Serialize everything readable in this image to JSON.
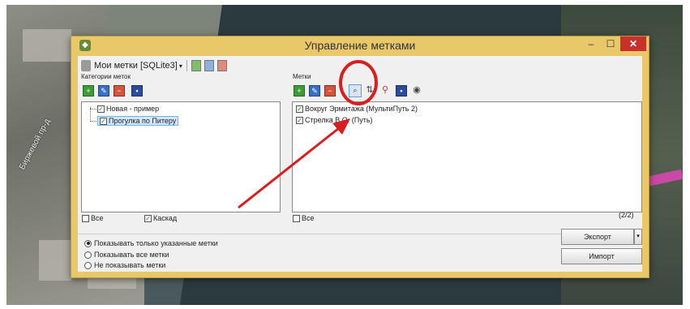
{
  "map": {
    "street_label": "Биржевой пр-д"
  },
  "window": {
    "title": "Управление метками",
    "minimize": "–",
    "maximize": "☐",
    "close": "✕"
  },
  "toolbar": {
    "database": "Мои метки [SQLite3]",
    "dropdown_arrow": "▾"
  },
  "categories": {
    "label": "Категории меток",
    "items": [
      {
        "label": "Новая - пример",
        "checked": true,
        "selected": false
      },
      {
        "label": "Прогулка по Питеру",
        "checked": true,
        "selected": true
      }
    ],
    "footer_all": "Все",
    "footer_cascade": "Каскад",
    "cascade_checked": true
  },
  "marks": {
    "label": "Метки",
    "items": [
      {
        "label": "Вокруг Эрмитажа (МультиПуть 2)",
        "checked": true
      },
      {
        "label": "Стрелка В.О. (Путь)",
        "checked": true
      }
    ],
    "footer_all": "Все",
    "count": "(2/2)"
  },
  "display": {
    "options": [
      {
        "label": "Показывать только указанные метки",
        "selected": true
      },
      {
        "label": "Показывать все метки",
        "selected": false
      },
      {
        "label": "Не показывать метки",
        "selected": false
      }
    ]
  },
  "buttons": {
    "export": "Экспорт",
    "import": "Импорт",
    "split_arrow": "▾"
  },
  "colors": {
    "window_frame": "#e9c86a",
    "close_button": "#c7312a",
    "annotation": "#d81e1e"
  },
  "icons": {
    "check": "✓",
    "search": "⌕",
    "eye": "◉",
    "pin": "⚲"
  }
}
